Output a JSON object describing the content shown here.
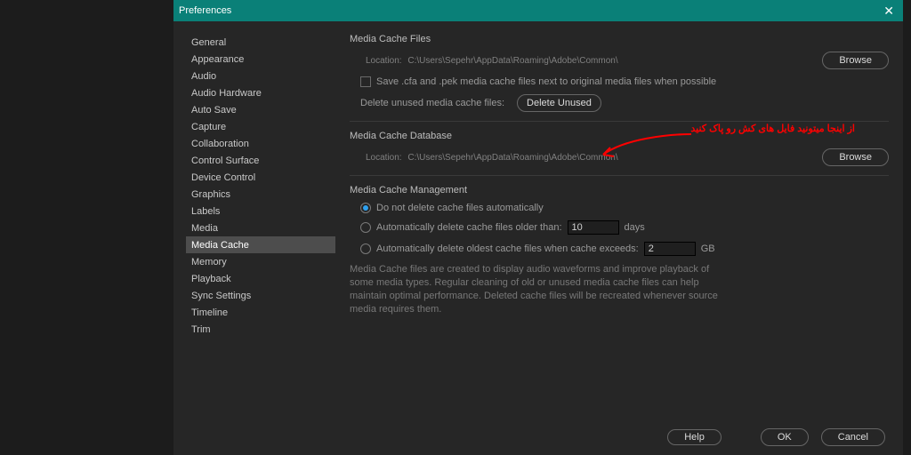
{
  "dialog": {
    "title": "Preferences"
  },
  "sidebar": {
    "items": [
      "General",
      "Appearance",
      "Audio",
      "Audio Hardware",
      "Auto Save",
      "Capture",
      "Collaboration",
      "Control Surface",
      "Device Control",
      "Graphics",
      "Labels",
      "Media",
      "Media Cache",
      "Memory",
      "Playback",
      "Sync Settings",
      "Timeline",
      "Trim"
    ],
    "selected_index": 12
  },
  "section1": {
    "title": "Media Cache Files",
    "location_label": "Location:",
    "location_path": "C:\\Users\\Sepehr\\AppData\\Roaming\\Adobe\\Common\\",
    "browse": "Browse",
    "checkbox_label": "Save .cfa and .pek media cache files next to original media files when possible",
    "delete_label": "Delete unused media cache files:",
    "delete_button": "Delete Unused"
  },
  "section2": {
    "title": "Media Cache Database",
    "location_label": "Location:",
    "location_path": "C:\\Users\\Sepehr\\AppData\\Roaming\\Adobe\\Common\\",
    "browse": "Browse"
  },
  "section3": {
    "title": "Media Cache Management",
    "opt1": "Do not delete cache files automatically",
    "opt2_pre": "Automatically delete cache files older than:",
    "opt2_value": "10",
    "opt2_unit": "days",
    "opt3_pre": "Automatically delete oldest cache files when cache exceeds:",
    "opt3_value": "2",
    "opt3_unit": "GB",
    "selected_option": 1,
    "description": "Media Cache files are created to display audio waveforms and improve playback of some media types. Regular cleaning of old or unused media cache files can help maintain optimal performance. Deleted cache files will be recreated whenever source media requires them."
  },
  "footer": {
    "help": "Help",
    "ok": "OK",
    "cancel": "Cancel"
  },
  "annotation": {
    "text": "از اینجا میتونید فایل های کش رو پاک کنید"
  },
  "colors": {
    "titlebar": "#0a8078",
    "annotation": "#ff0000"
  }
}
